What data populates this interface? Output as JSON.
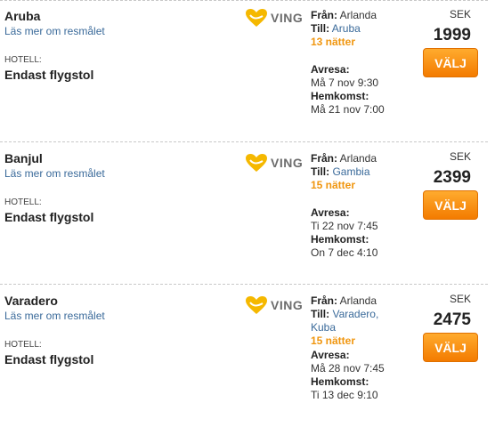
{
  "colors": {
    "link": "#3a6a9a",
    "nights": "#f0960f",
    "button": "#f58a07",
    "logo_heart": "#f5b800"
  },
  "labels": {
    "more": "Läs mer om resmålet",
    "hotel": "HOTELL:",
    "from": "Från:",
    "to": "Till:",
    "depart": "Avresa:",
    "return": "Hemkomst:",
    "currency": "SEK",
    "select": "VÄLJ",
    "brand": "VING"
  },
  "offers": [
    {
      "destination": "Aruba",
      "hotel": "Endast flygstol",
      "from": "Arlanda",
      "to_lines": [
        "Aruba"
      ],
      "nights": "13 nätter",
      "depart": "Må 7 nov 9:30",
      "return": "Må 21 nov 7:00",
      "price": "1999"
    },
    {
      "destination": "Banjul",
      "hotel": "Endast flygstol",
      "from": "Arlanda",
      "to_lines": [
        "Gambia"
      ],
      "nights": "15 nätter",
      "depart": "Ti 22 nov 7:45",
      "return": "On 7 dec 4:10",
      "price": "2399"
    },
    {
      "destination": "Varadero",
      "hotel": "Endast flygstol",
      "from": "Arlanda",
      "to_lines": [
        "Varadero,",
        "Kuba"
      ],
      "nights": "15 nätter",
      "depart": "Må 28 nov 7:45",
      "return": "Ti 13 dec 9:10",
      "price": "2475"
    }
  ]
}
